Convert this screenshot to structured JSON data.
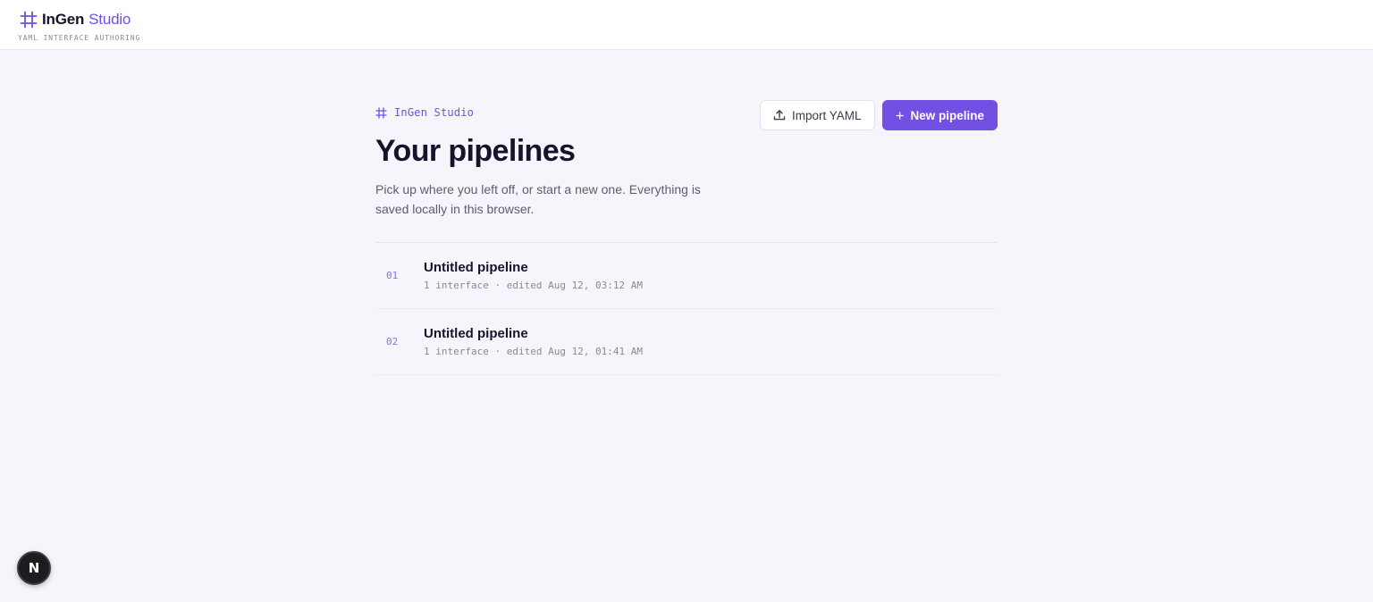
{
  "header": {
    "brand_name": "InGen",
    "brand_accent": "Studio",
    "tagline": "YAML INTERFACE AUTHORING",
    "logo_icon": "frame-grid-icon"
  },
  "main": {
    "eyebrow": "InGen Studio",
    "title": "Your pipelines",
    "subtitle": "Pick up where you left off, or start a new one. Everything is saved locally in this browser.",
    "actions": {
      "import_label": "Import YAML",
      "import_icon": "upload-icon",
      "new_label": "New pipeline",
      "new_icon": "plus-icon"
    },
    "pipelines": [
      {
        "index": "01",
        "title": "Untitled pipeline",
        "meta": "1 interface · edited Aug 12, 03:12 AM"
      },
      {
        "index": "02",
        "title": "Untitled pipeline",
        "meta": "1 interface · edited Aug 12, 01:41 AM"
      }
    ]
  },
  "dev_badge": {
    "letter": "N"
  },
  "colors": {
    "accent": "#7150e3",
    "background": "#f6f5fc",
    "text": "#15142a",
    "muted": "#8b8898"
  }
}
